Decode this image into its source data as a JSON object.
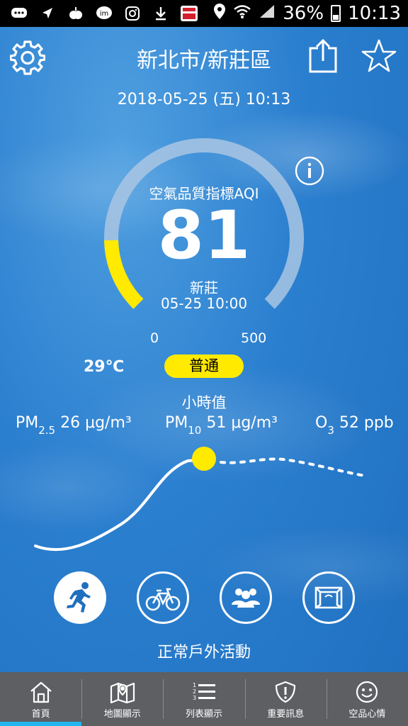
{
  "status_bar": {
    "icons": [
      "message-icon",
      "navigation-icon",
      "apple-app-icon",
      "im-icon",
      "instagram-icon",
      "download-icon",
      "news-app-icon"
    ],
    "right_icons": [
      "location-icon",
      "wifi-icon",
      "signal-icon"
    ],
    "battery": "36%",
    "time": "10:13"
  },
  "header": {
    "location": "新北市/新莊區",
    "datetime": "2018-05-25 (五) 10:13"
  },
  "aqi": {
    "title": "空氣品質指標AQI",
    "value": "81",
    "station": "新莊",
    "observed": "05-25 10:00",
    "scale_min": "0",
    "scale_max": "500",
    "gauge_fraction": 0.162,
    "status": "普通",
    "status_color": "#ffea00"
  },
  "temperature": "29℃",
  "hourly_label": "小時值",
  "pollutants": {
    "pm25": {
      "name": "PM",
      "sub": "2.5",
      "value": "26 μg/m³"
    },
    "pm10": {
      "name": "PM",
      "sub": "10",
      "value": "51 μg/m³"
    },
    "o3": {
      "name": "O",
      "sub": "3",
      "value": "52 ppb"
    }
  },
  "activities": {
    "items": [
      "running-icon",
      "bicycle-icon",
      "group-icon",
      "window-icon"
    ],
    "label": "正常戶外活動"
  },
  "tabs": [
    {
      "label": "首頁",
      "icon": "home-icon"
    },
    {
      "label": "地圖顯示",
      "icon": "map-icon"
    },
    {
      "label": "列表顯示",
      "icon": "list-icon"
    },
    {
      "label": "重要訊息",
      "icon": "alert-shield-icon"
    },
    {
      "label": "空品心情",
      "icon": "smiley-icon"
    }
  ],
  "colors": {
    "background": "#2b7fcf",
    "gauge_track": "#a9c5e3",
    "gauge_fill": "#ffea00",
    "tab_bar": "#5d5f62",
    "tab_active": "#22b5f0"
  }
}
